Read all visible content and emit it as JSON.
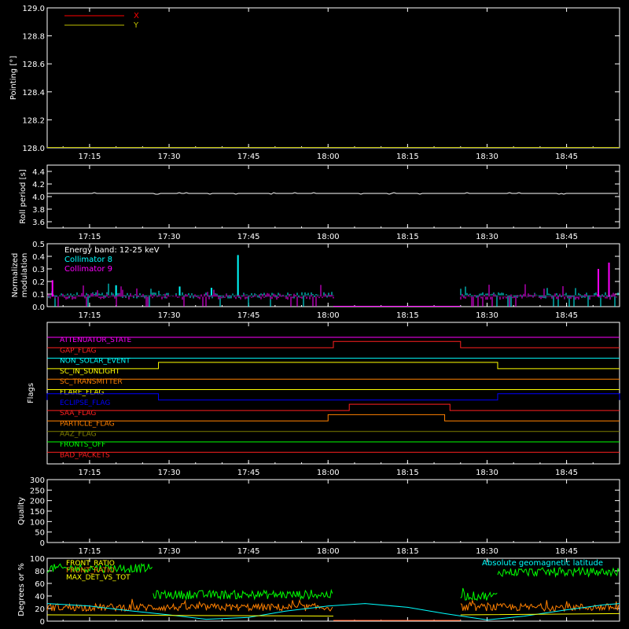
{
  "time_ticks": [
    "17:15",
    "17:30",
    "17:45",
    "18:00",
    "18:15",
    "18:30",
    "18:45"
  ],
  "chart_data": [
    {
      "id": "pointing",
      "type": "line",
      "ylabel": "Pointing [°]",
      "ylim": [
        128.0,
        129.0
      ],
      "yticks": [
        "128.0",
        "128.2",
        "128.4",
        "128.6",
        "128.8",
        "129.0"
      ],
      "legend": [
        {
          "name": "X",
          "color": "#ff0000"
        },
        {
          "name": "Y",
          "color": "#c0c000"
        }
      ],
      "series": [
        {
          "name": "X",
          "color": "#ff0000",
          "x": [
            "17:07",
            "18:55"
          ],
          "y": [
            128.0,
            128.0
          ]
        },
        {
          "name": "Y",
          "color": "#c0c000",
          "x": [
            "17:07",
            "18:55"
          ],
          "y": [
            128.0,
            128.0
          ]
        }
      ]
    },
    {
      "id": "roll",
      "type": "line",
      "ylabel": "Roll period [s]",
      "ylim": [
        3.5,
        4.5
      ],
      "yticks": [
        "3.6",
        "3.8",
        "4.0",
        "4.2",
        "4.4"
      ],
      "series": [
        {
          "name": "roll",
          "color": "#ffffff",
          "x": [
            "17:07",
            "18:55"
          ],
          "y": [
            4.05,
            4.05
          ]
        }
      ]
    },
    {
      "id": "modulation",
      "type": "bar",
      "ylabel": [
        "Normalized",
        "modulation"
      ],
      "ylim": [
        0,
        0.5
      ],
      "yticks": [
        "0.0",
        "0.1",
        "0.2",
        "0.3",
        "0.4",
        "0.5"
      ],
      "annotations": [
        "Energy band: 12-25 keV"
      ],
      "legend": [
        {
          "name": "Collimator 8",
          "color": "#00ffff"
        },
        {
          "name": "Collimator 9",
          "color": "#ff00ff"
        }
      ],
      "gap": [
        "18:01",
        "18:25"
      ],
      "series": [
        {
          "name": "Collimator 8",
          "color": "#00ffff",
          "level": 0.09,
          "spikes": [
            [
              "17:43",
              0.41
            ],
            [
              "17:38",
              0.15
            ],
            [
              "17:32",
              0.16
            ],
            [
              "17:20",
              0.17
            ]
          ]
        },
        {
          "name": "Collimator 9",
          "color": "#ff00ff",
          "level": 0.08,
          "spikes": [
            [
              "18:53",
              0.35
            ],
            [
              "17:08",
              0.21
            ],
            [
              "18:51",
              0.3
            ]
          ]
        }
      ]
    },
    {
      "id": "flags",
      "type": "line",
      "ylabel": "Flags",
      "series": [
        {
          "name": "ATTENUATOR_STATE",
          "color": "#ff00ff",
          "steps": []
        },
        {
          "name": "GAP_FLAG",
          "color": "#ff2020",
          "steps": [
            [
              "18:01",
              "18:25"
            ]
          ]
        },
        {
          "name": "NON_SOLAR_EVENT",
          "color": "#00ffff",
          "steps": []
        },
        {
          "name": "SC_IN_SUNLIGHT",
          "color": "#ffff00",
          "steps": [
            [
              "17:28",
              "18:32"
            ]
          ]
        },
        {
          "name": "SC_TRANSMITTER",
          "color": "#ff8000",
          "steps": []
        },
        {
          "name": "FLARE_FLAG",
          "color": "#ffff00",
          "steps": []
        },
        {
          "name": "ECLIPSE_FLAG",
          "color": "#0000ff",
          "steps": [
            [
              "17:07",
              "17:28"
            ],
            [
              "18:32",
              "18:55"
            ]
          ]
        },
        {
          "name": "SAA_FLAG",
          "color": "#ff2020",
          "steps": [
            [
              "18:04",
              "18:23"
            ]
          ]
        },
        {
          "name": "PARTICLE_FLAG",
          "color": "#ff8000",
          "steps": [
            [
              "18:00",
              "18:22"
            ]
          ]
        },
        {
          "name": "AAZ_FLAG",
          "color": "#808000",
          "steps": []
        },
        {
          "name": "FRONTS_OFF",
          "color": "#00ff00",
          "steps": []
        },
        {
          "name": "BAD_PACKETS",
          "color": "#ff2020",
          "steps": []
        }
      ]
    },
    {
      "id": "quality",
      "type": "line",
      "ylabel": "Quality",
      "ylim": [
        0,
        300
      ],
      "yticks": [
        "0",
        "50",
        "100",
        "150",
        "200",
        "250",
        "300"
      ]
    },
    {
      "id": "degrees",
      "type": "line",
      "ylabel": "Degrees or %",
      "ylim": [
        0,
        100
      ],
      "yticks": [
        "0",
        "20",
        "40",
        "60",
        "80",
        "100"
      ],
      "legend": [
        {
          "name": "FRONT_RATIO",
          "color": "#ffff00"
        },
        {
          "name": "FRONT_RATIO",
          "color": "#ff8000"
        },
        {
          "name": "MAX_DET_VS_TOT",
          "color": "#ffff00"
        }
      ],
      "annotations": [
        "Absolute geomagnetic latitude"
      ],
      "annotation_color": "#00ffff",
      "gap": [
        "18:01",
        "18:25"
      ],
      "series": [
        {
          "name": "green",
          "color": "#00ff00",
          "segments": [
            [
              "17:07",
              "17:27",
              84
            ],
            [
              "17:27",
              "18:01",
              42
            ],
            [
              "18:25",
              "18:32",
              40
            ],
            [
              "18:32",
              "18:55",
              78
            ]
          ]
        },
        {
          "name": "orange",
          "color": "#ff8000",
          "segments": [
            [
              "17:07",
              "18:01",
              22
            ],
            [
              "18:25",
              "18:55",
              22
            ]
          ]
        },
        {
          "name": "latitude",
          "color": "#00ffff",
          "x": [
            "17:07",
            "17:15",
            "17:22",
            "17:30",
            "17:37",
            "17:45",
            "17:52",
            "18:00",
            "18:07",
            "18:15",
            "18:22",
            "18:30",
            "18:37",
            "18:45",
            "18:52",
            "18:55"
          ],
          "y": [
            28,
            24,
            17,
            10,
            3,
            6,
            16,
            24,
            28,
            22,
            12,
            2,
            8,
            18,
            26,
            28
          ]
        }
      ]
    }
  ]
}
